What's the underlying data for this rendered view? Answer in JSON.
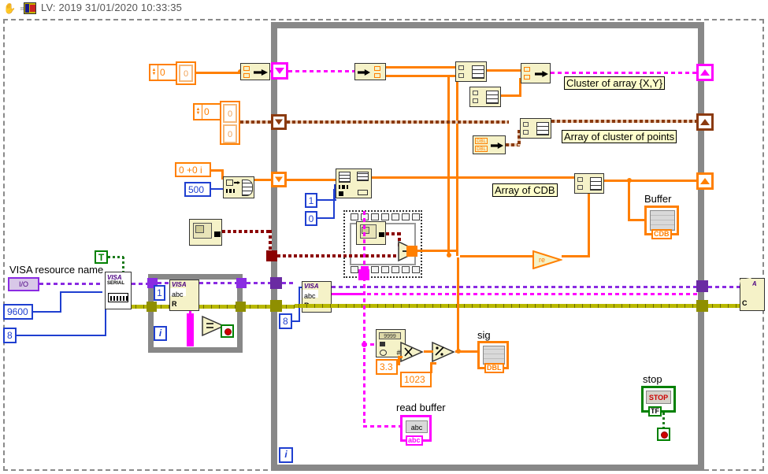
{
  "window": {
    "title": "LV: 2019 31/01/2020 10:33:35",
    "icons": [
      "hand-cursor-icon",
      "run-arrow-icon",
      "labview-vi-icon"
    ]
  },
  "labels": {
    "cluster_of_array": "Cluster of array {X,Y}",
    "array_of_cluster": "Array of cluster of points",
    "array_of_cdb": "Array of CDB",
    "buffer": "Buffer",
    "sig": "sig",
    "read_buffer": "read buffer",
    "stop": "stop",
    "visa_resource_name": "VISA resource name"
  },
  "constants": {
    "zero_a": "0",
    "array_cell_a": "0",
    "zero_b": "0",
    "array_cell_b1": "0",
    "array_cell_b2": "0",
    "complex_zero": "0 +0 i",
    "samples": "500",
    "one": "1",
    "zero_c": "0",
    "baud": "9600",
    "data_bits": "8",
    "byte_count_inner": "1",
    "byte_count_read": "8",
    "volt_ref": "3.3",
    "adc_max": "1023",
    "true_const": "T"
  },
  "terminals": {
    "io_terminal": "I/O",
    "iteration_outer": "i",
    "iteration_inner": "i",
    "dbl_tag": "DBL",
    "cdb_tag": "CDB",
    "abc_tag": "abc",
    "tf_tag": "TF",
    "stop_button_text": "STOP",
    "string_abc": "abc",
    "visa_serial_label": "VISA",
    "visa_serial_sub": "SERIAL",
    "visa_read_label": "VISA",
    "visa_read_sub": "abc",
    "visa_read_r": "R",
    "visa_close_label": "VISA",
    "visa_close_c": "C",
    "dbl_bundle_1": "DBL",
    "dbl_bundle_2": "DBL"
  },
  "colors": {
    "wire_orange": "#ff7f00",
    "wire_blue": "#1f3fd0",
    "wire_pink": "#ff00ff",
    "wire_purple": "#8a2be2",
    "wire_yellow": "#b8b800",
    "wire_brown": "#8b3a0f",
    "wire_darkred": "#8b0000",
    "structure_gray": "#888888",
    "node_fill": "#f5f2c8",
    "label_fill": "#ffffcc"
  }
}
